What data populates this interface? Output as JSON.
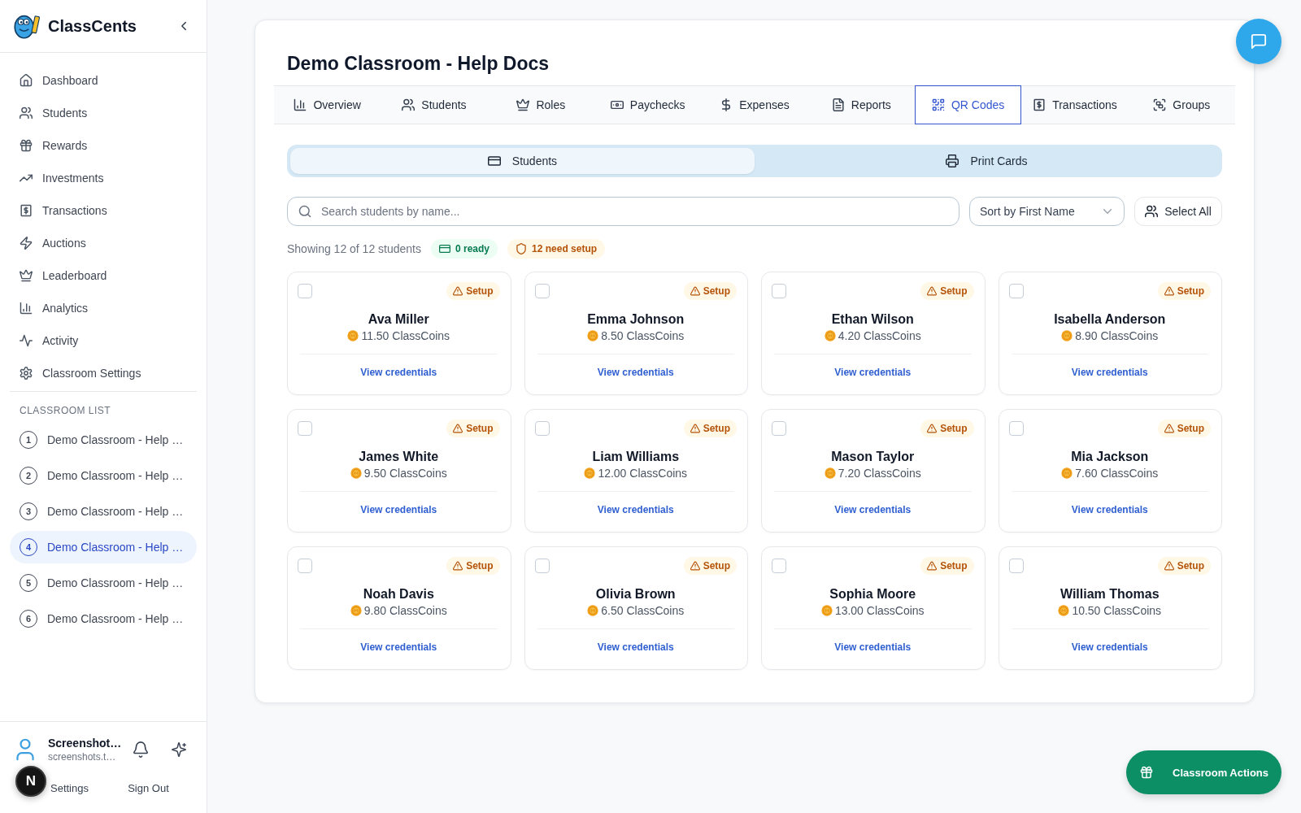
{
  "sidebar": {
    "brand": "ClassCents",
    "nav": [
      {
        "label": "Dashboard"
      },
      {
        "label": "Students"
      },
      {
        "label": "Rewards"
      },
      {
        "label": "Investments"
      },
      {
        "label": "Transactions"
      },
      {
        "label": "Auctions"
      },
      {
        "label": "Leaderboard"
      },
      {
        "label": "Analytics"
      },
      {
        "label": "Activity"
      },
      {
        "label": "Classroom Settings"
      }
    ],
    "section_title": "CLASSROOM LIST",
    "classrooms": [
      {
        "number": "1",
        "name": "Demo Classroom - Help …",
        "selected": false
      },
      {
        "number": "2",
        "name": "Demo Classroom - Help …",
        "selected": false
      },
      {
        "number": "3",
        "name": "Demo Classroom - Help …",
        "selected": false
      },
      {
        "number": "4",
        "name": "Demo Classroom - Help …",
        "selected": true
      },
      {
        "number": "5",
        "name": "Demo Classroom - Help …",
        "selected": false
      },
      {
        "number": "6",
        "name": "Demo Classroom - Help …",
        "selected": false
      }
    ],
    "user": {
      "name": "Screenshot…",
      "email": "screenshots.t…"
    },
    "footer_links": [
      "Settings",
      "Sign Out"
    ]
  },
  "dev_indicator": {
    "label": "N"
  },
  "page": {
    "title": "Demo Classroom - Help Docs"
  },
  "tabs": [
    {
      "label": "Overview",
      "selected": false
    },
    {
      "label": "Students",
      "selected": false
    },
    {
      "label": "Roles",
      "selected": false
    },
    {
      "label": "Paychecks",
      "selected": false
    },
    {
      "label": "Expenses",
      "selected": false
    },
    {
      "label": "Reports",
      "selected": false
    },
    {
      "label": "QR Codes",
      "selected": true
    },
    {
      "label": "Transactions",
      "selected": false
    },
    {
      "label": "Groups",
      "selected": false
    }
  ],
  "view_toggle": [
    {
      "label": "Students",
      "selected": true
    },
    {
      "label": "Print Cards",
      "selected": false
    }
  ],
  "toolbar": {
    "search": {
      "placeholder": "Search students by name..."
    },
    "sort": {
      "value": "Sort by First Name"
    },
    "select_all": "Select All"
  },
  "summary": {
    "text": "Showing 12 of 12 students",
    "badges": [
      {
        "kind": "ready",
        "label": "0 ready"
      },
      {
        "kind": "setup",
        "label": "12 need setup"
      }
    ]
  },
  "students": [
    {
      "name": "Ava Miller",
      "balance": "11.50 ClassCoins",
      "status": "Setup",
      "checked": false,
      "link": "View credentials"
    },
    {
      "name": "Emma Johnson",
      "balance": "8.50 ClassCoins",
      "status": "Setup",
      "checked": false,
      "link": "View credentials"
    },
    {
      "name": "Ethan Wilson",
      "balance": "4.20 ClassCoins",
      "status": "Setup",
      "checked": false,
      "link": "View credentials"
    },
    {
      "name": "Isabella Anderson",
      "balance": "8.90 ClassCoins",
      "status": "Setup",
      "checked": false,
      "link": "View credentials"
    },
    {
      "name": "James White",
      "balance": "9.50 ClassCoins",
      "status": "Setup",
      "checked": false,
      "link": "View credentials"
    },
    {
      "name": "Liam Williams",
      "balance": "12.00 ClassCoins",
      "status": "Setup",
      "checked": false,
      "link": "View credentials"
    },
    {
      "name": "Mason Taylor",
      "balance": "7.20 ClassCoins",
      "status": "Setup",
      "checked": false,
      "link": "View credentials"
    },
    {
      "name": "Mia Jackson",
      "balance": "7.60 ClassCoins",
      "status": "Setup",
      "checked": false,
      "link": "View credentials"
    },
    {
      "name": "Noah Davis",
      "balance": "9.80 ClassCoins",
      "status": "Setup",
      "checked": false,
      "link": "View credentials"
    },
    {
      "name": "Olivia Brown",
      "balance": "6.50 ClassCoins",
      "status": "Setup",
      "checked": false,
      "link": "View credentials"
    },
    {
      "name": "Sophia Moore",
      "balance": "13.00 ClassCoins",
      "status": "Setup",
      "checked": false,
      "link": "View credentials"
    },
    {
      "name": "William Thomas",
      "balance": "10.50 ClassCoins",
      "status": "Setup",
      "checked": false,
      "link": "View credentials"
    }
  ],
  "actions_button": {
    "label": "Classroom Actions"
  }
}
